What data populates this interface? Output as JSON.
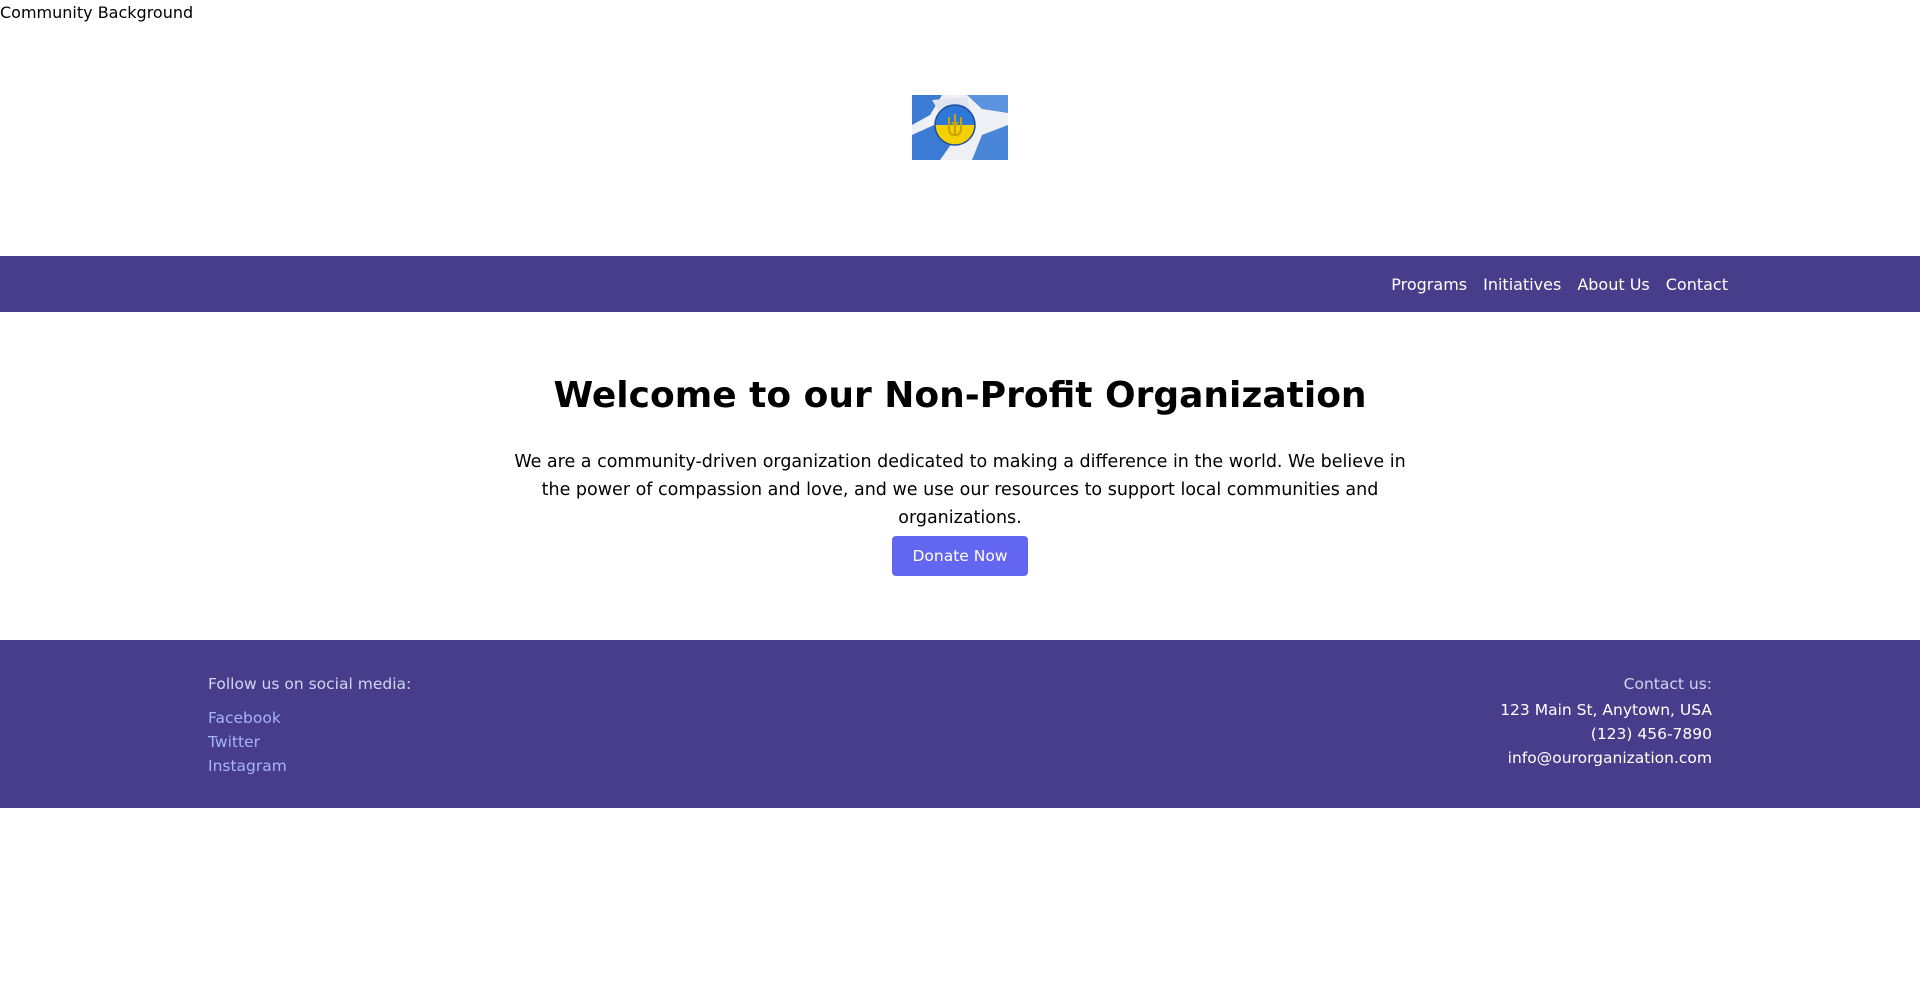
{
  "background_image": {
    "alt_text": "Community Background"
  },
  "logo": {
    "icon": "ukraine-trident-badge-icon",
    "colors": {
      "blue": "#3b7bd4",
      "yellow": "#f5d000",
      "white": "#f2f3f7"
    }
  },
  "nav": {
    "background": "#483d8b",
    "items": [
      {
        "label": "Programs"
      },
      {
        "label": "Initiatives"
      },
      {
        "label": "About Us"
      },
      {
        "label": "Contact"
      }
    ]
  },
  "hero": {
    "title": "Welcome to our Non-Profit Organization",
    "text": "We are a community-driven organization dedicated to making a difference in the world. We believe in the power of compassion and love, and we use our resources to support local communities and organizations.",
    "donate_label": "Donate Now",
    "donate_color": "#6366f1"
  },
  "footer": {
    "background": "#483d8b",
    "social_heading": "Follow us on social media:",
    "social_links": [
      {
        "label": "Facebook"
      },
      {
        "label": "Twitter"
      },
      {
        "label": "Instagram"
      }
    ],
    "contact_heading": "Contact us:",
    "address": "123 Main St, Anytown, USA",
    "phone": "(123) 456-7890",
    "email": "info@ourorganization.com"
  }
}
